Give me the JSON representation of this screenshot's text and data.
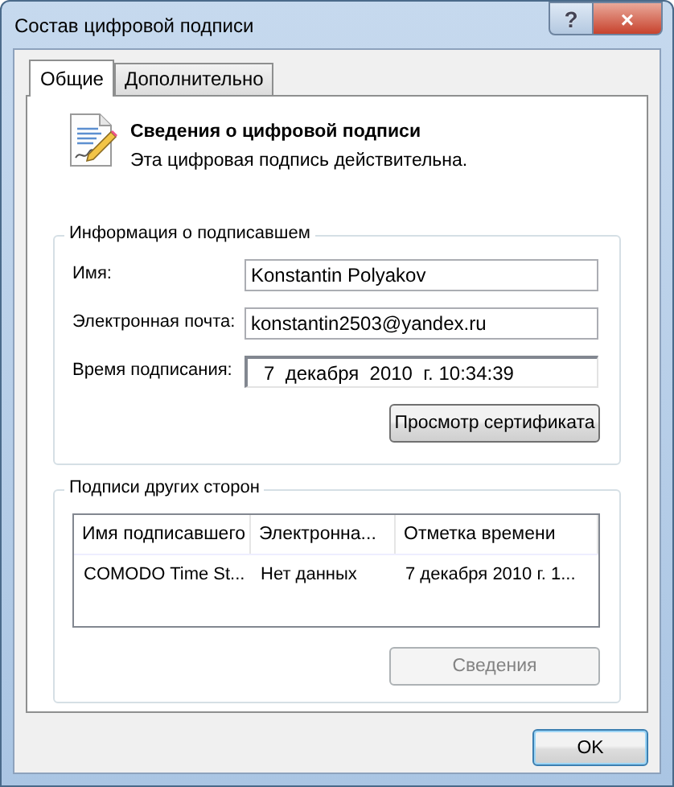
{
  "window": {
    "title": "Состав цифровой подписи",
    "caption_buttons": [
      {
        "kind": "help",
        "label": "?"
      },
      {
        "kind": "close",
        "label": "×"
      }
    ]
  },
  "tabs": [
    {
      "label": "Общие",
      "selected": true
    },
    {
      "label": "Дополнительно",
      "selected": false
    }
  ],
  "header": {
    "title": "Сведения о цифровой подписи",
    "subtitle": "Эта цифровая подпись действительна."
  },
  "signer_group": {
    "title": "Информация о подписавшем",
    "fields": [
      {
        "label": "Имя:",
        "value": "Konstantin Polyakov",
        "kind": "text"
      },
      {
        "label": "Электронная почта:",
        "value": "konstantin2503@yandex.ru",
        "kind": "text"
      },
      {
        "label": "Время подписания:",
        "value": "7  декабря  2010  г. 10:34:39",
        "kind": "datetime"
      }
    ],
    "button": {
      "label": "Просмотр сертификата",
      "disabled": false
    }
  },
  "countersignatures_group": {
    "title": "Подписи других сторон",
    "table": {
      "columns": [
        "Имя подписавшего",
        "Электронна...",
        "Отметка времени"
      ],
      "rows": [
        [
          "COMODO Time St...",
          "Нет данных",
          "7 декабря 2010 г. 1..."
        ]
      ]
    },
    "button": {
      "label": "Сведения",
      "disabled": true
    }
  },
  "buttons": [
    "OK"
  ]
}
